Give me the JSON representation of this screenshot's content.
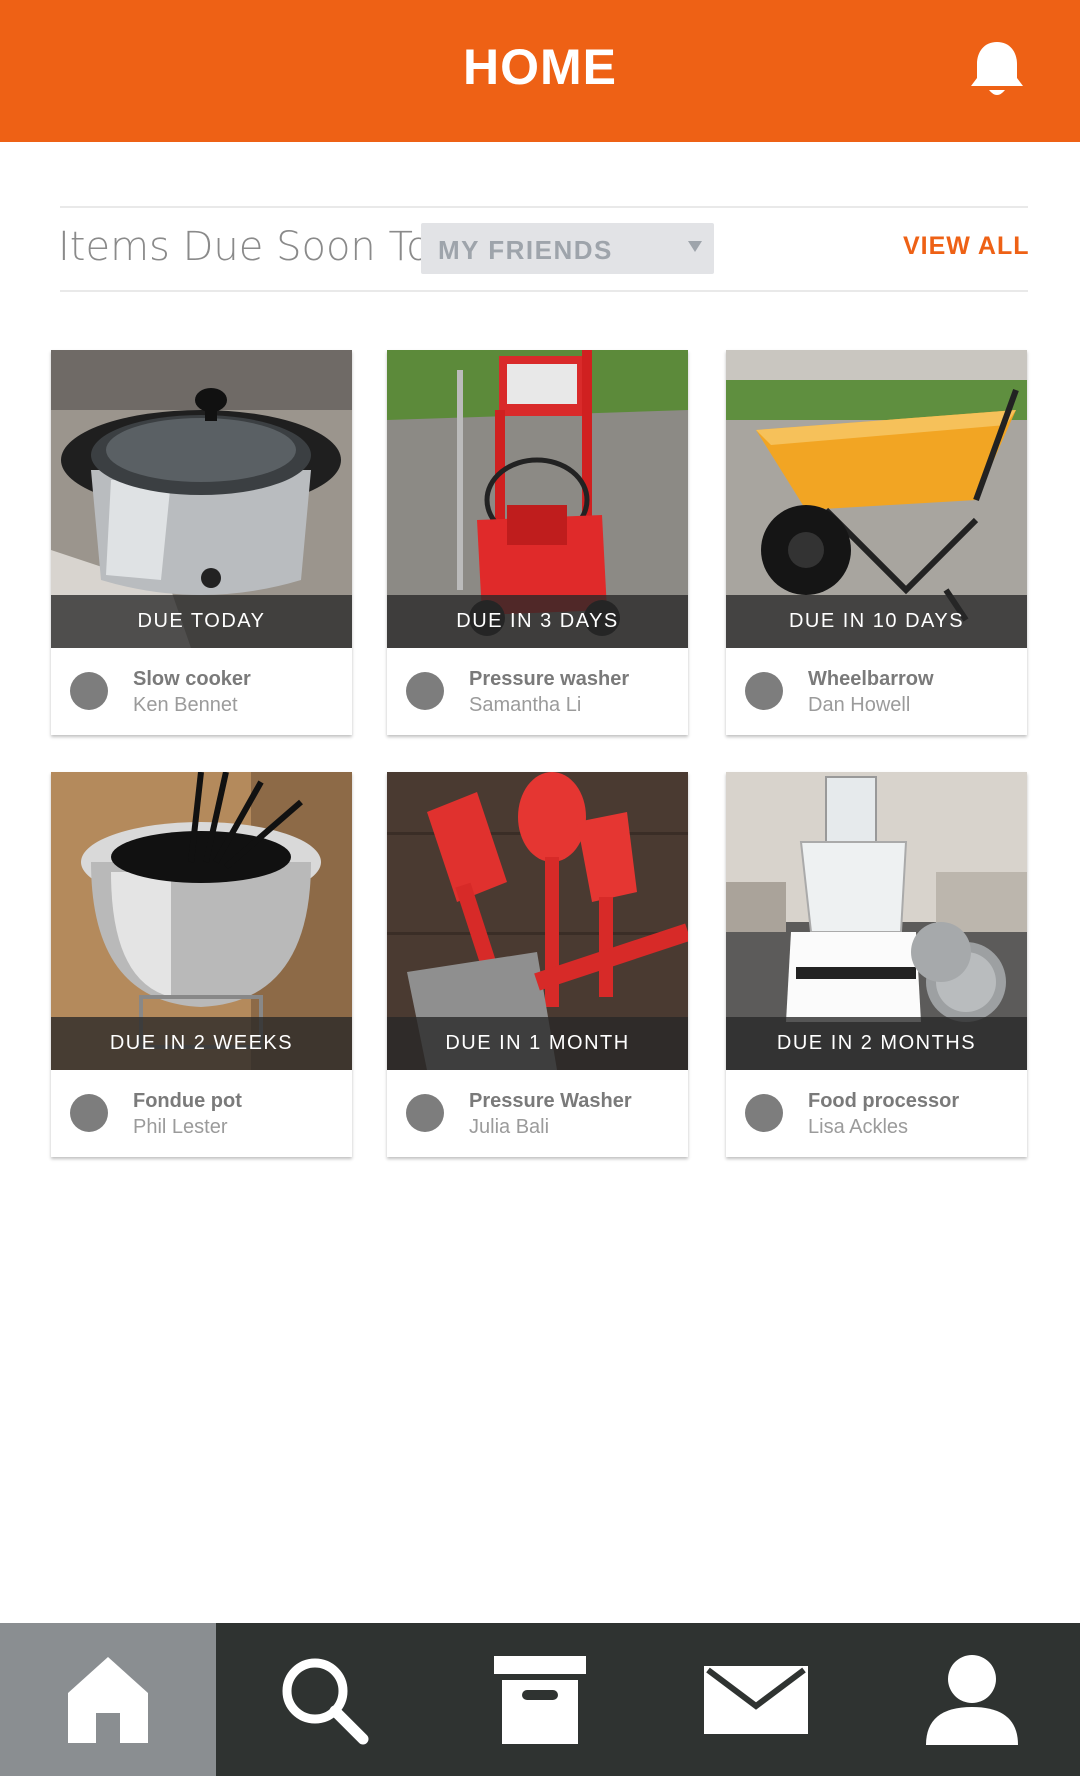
{
  "header": {
    "title": "HOME",
    "bell_icon": "bell-icon"
  },
  "section": {
    "title": "Items Due Soon To",
    "filter_value": "MY FRIENDS",
    "view_all": "VIEW ALL"
  },
  "items": [
    {
      "due": "DUE TODAY",
      "name": "Slow cooker",
      "owner": "Ken Bennet"
    },
    {
      "due": "DUE IN 3 DAYS",
      "name": "Pressure washer",
      "owner": "Samantha Li"
    },
    {
      "due": "DUE IN 10 DAYS",
      "name": "Wheelbarrow",
      "owner": "Dan Howell"
    },
    {
      "due": "DUE IN 2 WEEKS",
      "name": "Fondue pot",
      "owner": "Phil Lester"
    },
    {
      "due": "DUE IN 1 MONTH",
      "name": "Pressure Washer",
      "owner": "Julia Bali"
    },
    {
      "due": "DUE IN 2 MONTHS",
      "name": "Food processor",
      "owner": "Lisa Ackles"
    }
  ],
  "tabbar": {
    "tabs": [
      {
        "icon": "home-icon",
        "active": true
      },
      {
        "icon": "search-icon",
        "active": false
      },
      {
        "icon": "archive-box-icon",
        "active": false
      },
      {
        "icon": "mail-icon",
        "active": false
      },
      {
        "icon": "profile-icon",
        "active": false
      }
    ]
  },
  "colors": {
    "accent": "#ee6115",
    "tabbar": "#2f3331",
    "tab_active": "#8a8e91"
  }
}
